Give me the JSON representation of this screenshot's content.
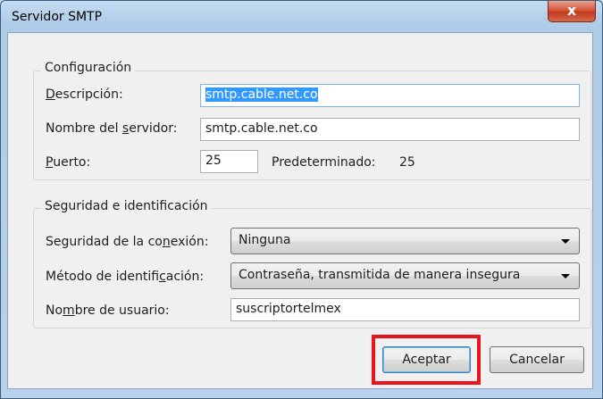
{
  "window": {
    "title": "Servidor SMTP",
    "close_label": "x"
  },
  "config": {
    "group_title": "Configuración",
    "description": {
      "label_ul": "D",
      "label_rest": "escripción:",
      "value": "smtp.cable.net.co"
    },
    "server": {
      "label_pre": "Nombre del ",
      "label_ul": "s",
      "label_rest": "ervidor:",
      "value": "smtp.cable.net.co"
    },
    "port": {
      "label_ul": "P",
      "label_rest": "uerto:",
      "value": "25",
      "default_label": "Predeterminado:",
      "default_value": "25"
    }
  },
  "security": {
    "group_title": "Seguridad e identificación",
    "connection": {
      "label_pre": "Seguridad de la co",
      "label_ul": "n",
      "label_rest": "exión:",
      "value": "Ninguna"
    },
    "auth": {
      "label_pre": "Método de identifi",
      "label_ul": "c",
      "label_rest": "ación:",
      "value": "Contraseña, transmitida de manera insegura"
    },
    "username": {
      "label_pre": "No",
      "label_ul": "m",
      "label_rest": "bre de usuario:",
      "value": "suscriptortelmex"
    }
  },
  "buttons": {
    "ok": "Aceptar",
    "cancel": "Cancelar"
  },
  "colors": {
    "highlight": "#e8131b",
    "selection": "#3399ff"
  }
}
